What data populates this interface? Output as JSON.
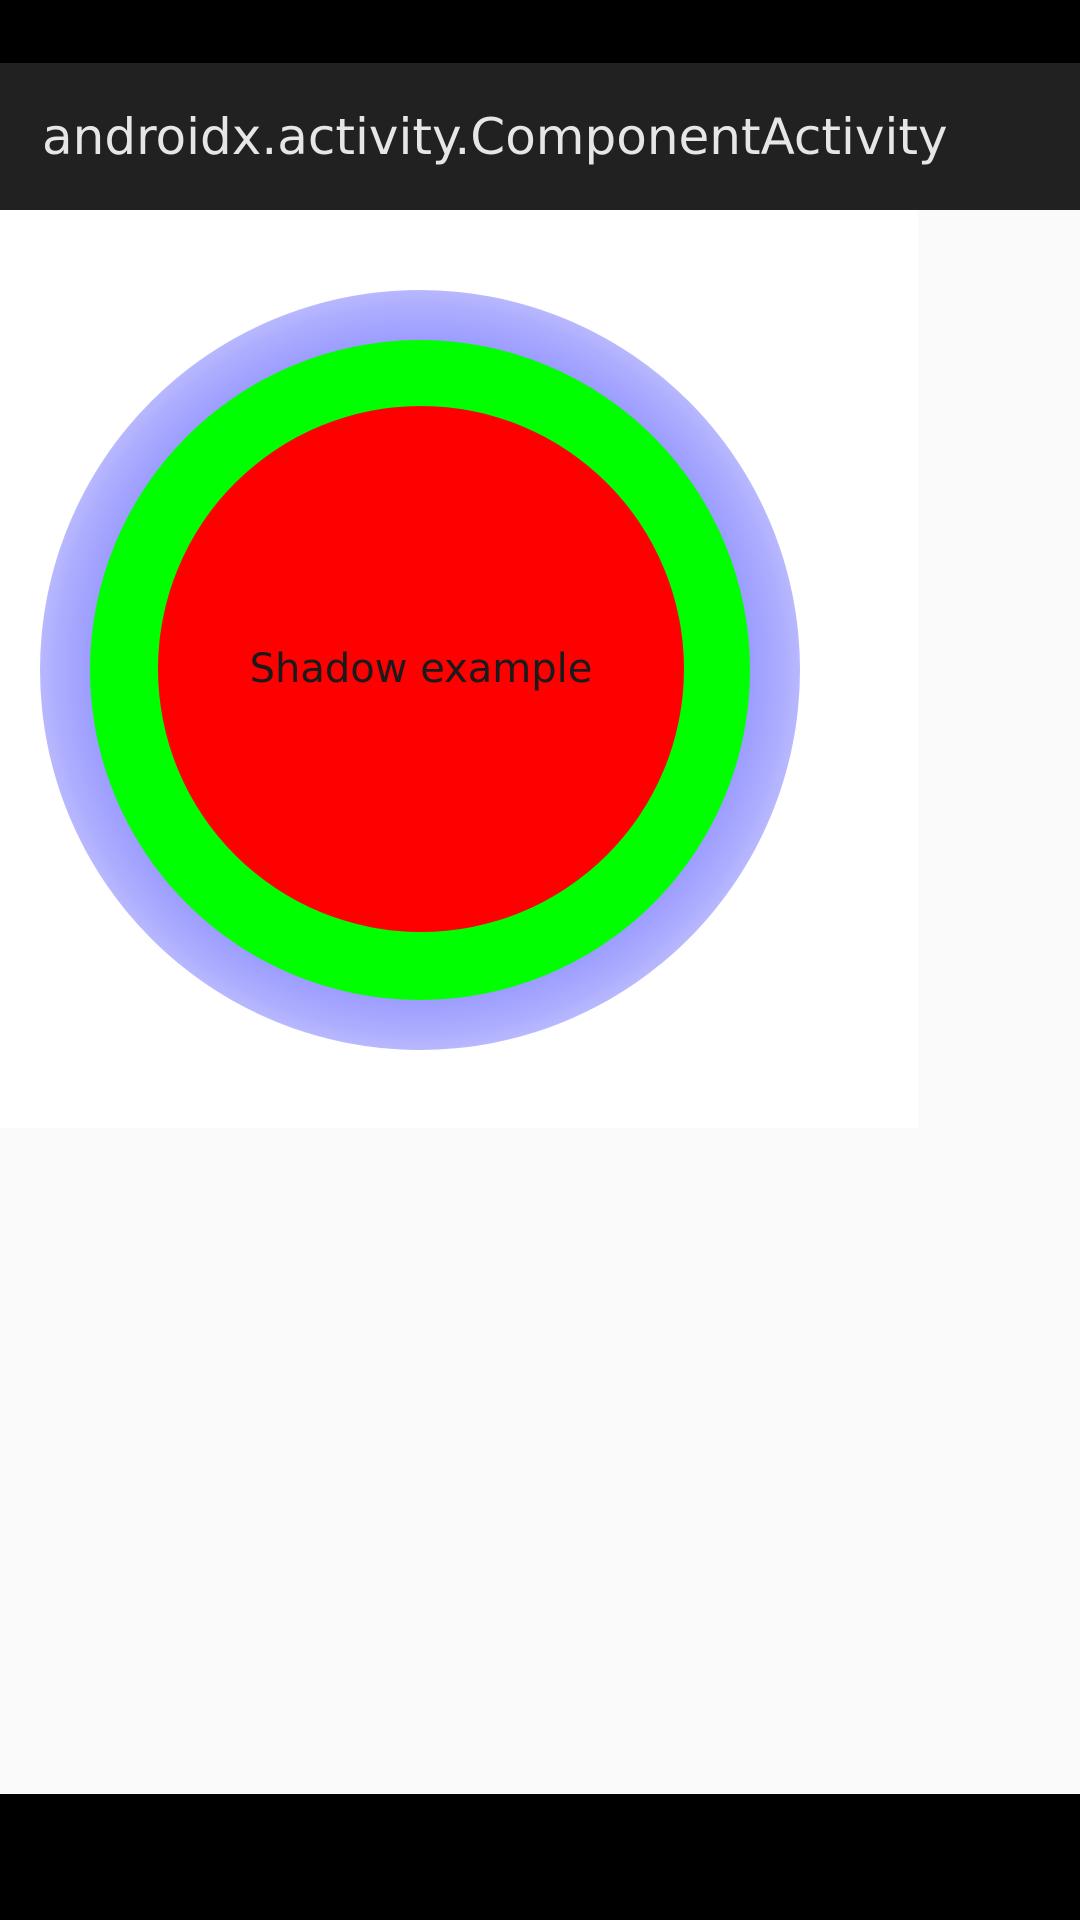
{
  "app_bar": {
    "title": "androidx.activity.ComponentActivity"
  },
  "content": {
    "shadow_circle_label": "Shadow example"
  },
  "colors": {
    "status_bar": "#000000",
    "app_bar": "#212121",
    "title_text": "#e6e6e6",
    "panel": "#ffffff",
    "background": "#fafafa",
    "circle_fill": "#ff0000",
    "inner_glow": "#00ff00",
    "outer_glow": "#8c8cff",
    "nav_bar": "#000000"
  }
}
